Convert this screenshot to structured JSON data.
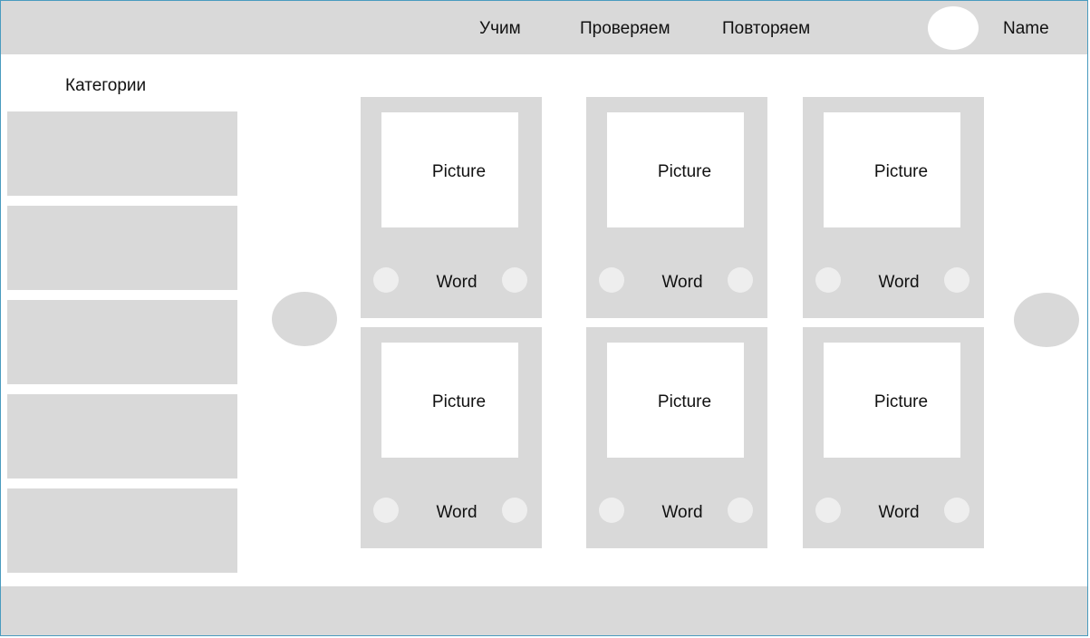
{
  "header": {
    "nav": [
      "Учим",
      "Проверяем",
      "Повторяем"
    ],
    "user_name": "Name"
  },
  "sidebar": {
    "title": "Категории",
    "item_count": 5
  },
  "cards": [
    {
      "picture": "Picture",
      "word": "Word"
    },
    {
      "picture": "Picture",
      "word": "Word"
    },
    {
      "picture": "Picture",
      "word": "Word"
    },
    {
      "picture": "Picture",
      "word": "Word"
    },
    {
      "picture": "Picture",
      "word": "Word"
    },
    {
      "picture": "Picture",
      "word": "Word"
    }
  ],
  "colors": {
    "panel": "#d9d9d9",
    "surface": "#ffffff",
    "dot": "#eeeeee",
    "frame": "#4a9bbf"
  }
}
